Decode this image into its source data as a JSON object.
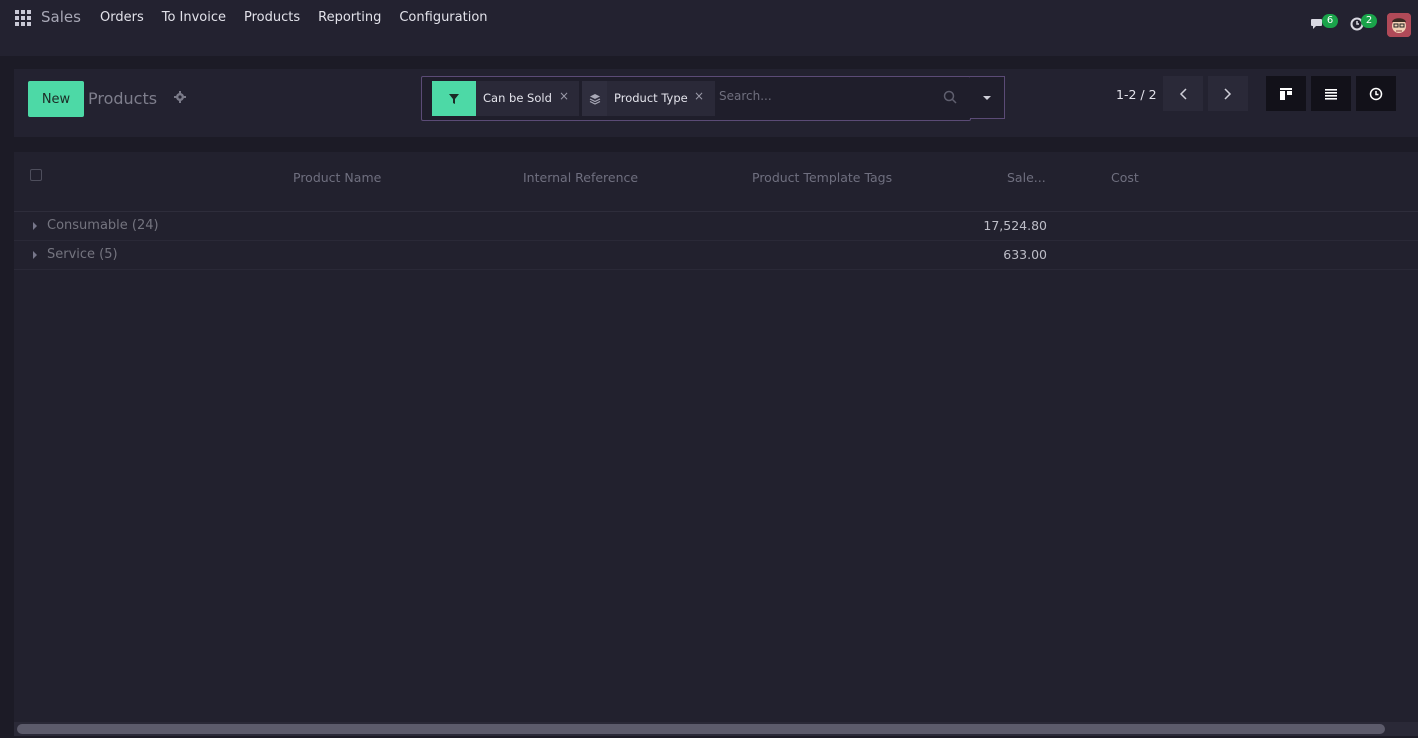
{
  "navbar": {
    "app_name": "Sales",
    "menu": [
      "Orders",
      "To Invoice",
      "Products",
      "Reporting",
      "Configuration"
    ],
    "messages_count": "6",
    "activities_count": "2",
    "icons": [
      "apps-icon",
      "chat-icon",
      "clock-icon",
      "avatar"
    ]
  },
  "control_panel": {
    "new_label": "New",
    "title": "Products",
    "search": {
      "facets": [
        {
          "icon": "filter-icon",
          "label": "Can be Sold"
        },
        {
          "icon": "layers-icon",
          "label": "Product Type"
        }
      ],
      "placeholder": "Search..."
    },
    "pager": "1-2 / 2"
  },
  "list": {
    "columns": [
      "Product Name",
      "Internal Reference",
      "Product Template Tags",
      "Sale...",
      "Cost"
    ],
    "groups": [
      {
        "label": "Consumable (24)",
        "sales_price": "17,524.80"
      },
      {
        "label": "Service (5)",
        "sales_price": "633.00"
      }
    ]
  },
  "colors": {
    "accent": "#4dd9a6",
    "badge": "#1aa34a",
    "search_border": "#5b4b76"
  }
}
